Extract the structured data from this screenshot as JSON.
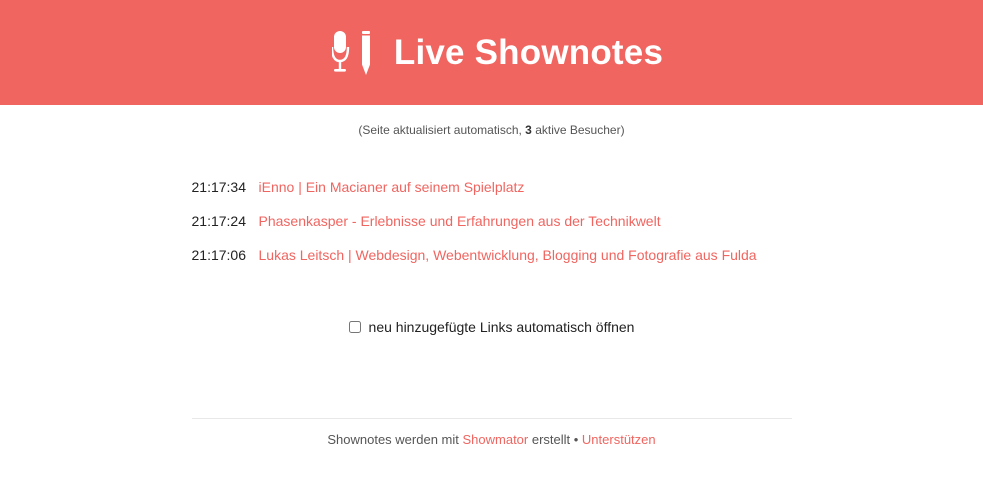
{
  "header": {
    "title": "Live Shownotes",
    "logo_icon": "microphone-pencil-icon",
    "background_color": "#f06560"
  },
  "status": {
    "prefix": "(Seite aktualisiert automatisch, ",
    "visitor_count": "3",
    "suffix": " aktive Besucher)"
  },
  "entries": [
    {
      "time": "21:17:34",
      "title": "iEnno | Ein Macianer auf seinem Spielplatz"
    },
    {
      "time": "21:17:24",
      "title": "Phasenkasper - Erlebnisse und Erfahrungen aus der Technikwelt"
    },
    {
      "time": "21:17:06",
      "title": "Lukas Leitsch | Webdesign, Webentwicklung, Blogging und Fotografie aus Fulda"
    }
  ],
  "auto_open": {
    "label": "neu hinzugefügte Links automatisch öffnen",
    "checked": false
  },
  "footer": {
    "prefix": "Shownotes werden mit ",
    "showmator_link": "Showmator",
    "middle": " erstellt • ",
    "support_link": "Unterstützen"
  },
  "colors": {
    "accent": "#f06560",
    "text": "#222222",
    "muted": "#555555"
  }
}
